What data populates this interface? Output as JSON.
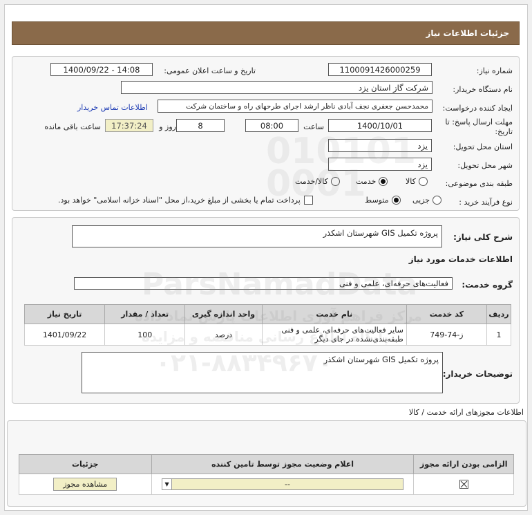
{
  "header": {
    "title": "جزئیات اطلاعات نیاز"
  },
  "need_info": {
    "need_number_label": "شماره نیاز:",
    "need_number": "1100091426000259",
    "announce_label": "تاریخ و ساعت اعلان عمومی:",
    "announce_value": "1400/09/22 - 14:08",
    "buyer_org_label": "نام دستگاه خریدار:",
    "buyer_org": "شرکت گاز استان یزد",
    "requester_label": "ایجاد کننده درخواست:",
    "requester": "محمدحسن جعفری نجف آبادی ناظر ارشد اجرای طرحهای راه و ساختمان شرکت",
    "contact_link": "اطلاعات تماس خریدار",
    "deadline_label": "مهلت ارسال پاسخ: تا",
    "deadline_label2": "تاریخ:",
    "deadline_date": "1400/10/01",
    "time_label": "ساعت",
    "deadline_time": "08:00",
    "days_value": "8",
    "days_label": "روز و",
    "remaining_time": "17:37:24",
    "remaining_label": "ساعت باقی مانده",
    "province_label": "استان محل تحویل:",
    "province": "یزد",
    "city_label": "شهر محل تحویل:",
    "city": "یزد",
    "category_label": "طبقه بندی موضوعی:",
    "category_options": [
      "کالا",
      "خدمت",
      "کالا/خدمت"
    ],
    "category_selected": "خدمت",
    "purchase_type_label": "نوع فرآیند خرید :",
    "purchase_options": [
      "جزیی",
      "متوسط"
    ],
    "purchase_selected": "متوسط",
    "treasury_note": "پرداخت تمام یا بخشی از مبلغ خرید،از محل \"اسناد خزانه اسلامی\" خواهد بود."
  },
  "summary": {
    "label": "شرح کلی نیاز:",
    "value": "پروژه تکمیل GIS شهرستان اشکذر"
  },
  "services": {
    "section_title": "اطلاعات خدمات مورد نیاز",
    "group_label": "گروه خدمت:",
    "group_value": "فعالیت‌های حرفه‌ای، علمی و فنی",
    "columns": [
      "ردیف",
      "کد خدمت",
      "نام خدمت",
      "واحد اندازه گیری",
      "تعداد / مقدار",
      "تاریخ نیاز"
    ],
    "rows": [
      {
        "row": "1",
        "code": "ز-74-749",
        "name": "سایر فعالیت‌های حرفه‌ای، علمی و فنی طبقه‌بندی‌نشده در جای دیگر",
        "unit": "درصد",
        "qty": "100",
        "date": "1401/09/22"
      }
    ]
  },
  "buyer_notes": {
    "label": "توضیحات خریدار:",
    "value": "پروژه تکمیل GIS شهرستان اشکذر"
  },
  "permits": {
    "section_title": "اطلاعات مجوزهای ارائه خدمت / کالا",
    "columns": [
      "الزامی بودن ارائه مجوز",
      "اعلام وضعیت مجوز توسط تامین کننده",
      "جزئیات"
    ],
    "select_value": "--",
    "view_button": "مشاهده مجوز"
  },
  "watermark": {
    "line1": "ParsNamadData",
    "line2": "مرکز فراهم آوری اطلاعات پارس نماد داده",
    "line3": "پایگاه اطلاع رسانی مناقصه و مزایده",
    "line4": "۰۲۱-۸۸۳۴۹۶۷۰"
  },
  "colors": {
    "header_bg": "#8a6a4a",
    "highlight_field": "#f2efc6",
    "link": "#1e3cb4"
  }
}
